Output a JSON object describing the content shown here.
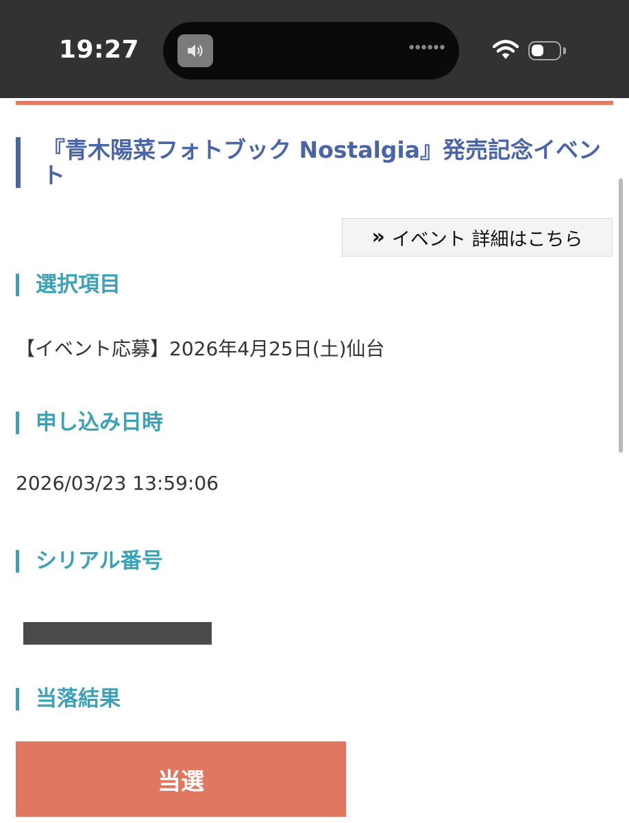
{
  "status_bar": {
    "time": "19:27",
    "island_dots": "••••••"
  },
  "event": {
    "title": "『青木陽菜フォトブック Nostalgia』発売記念イベント",
    "detail_button_label": "イベント 詳細はこちら"
  },
  "sections": {
    "selection": {
      "heading": "選択項目",
      "value": "【イベント応募】2026年4月25日(土)仙台"
    },
    "applied_at": {
      "heading": "申し込み日時",
      "value": "2026/03/23 13:59:06"
    },
    "serial": {
      "heading": "シリアル番号"
    },
    "result": {
      "heading": "当落結果",
      "value": "当選"
    }
  },
  "colors": {
    "accent_orange": "#e8795f",
    "title_blue": "#4a64a8",
    "heading_teal": "#3aa1b7",
    "result_button": "#e07861"
  },
  "icons": {
    "sound": "speaker-icon",
    "wifi": "wifi-icon",
    "battery": "battery-icon",
    "detail_arrow": "double-chevron-right-icon"
  }
}
